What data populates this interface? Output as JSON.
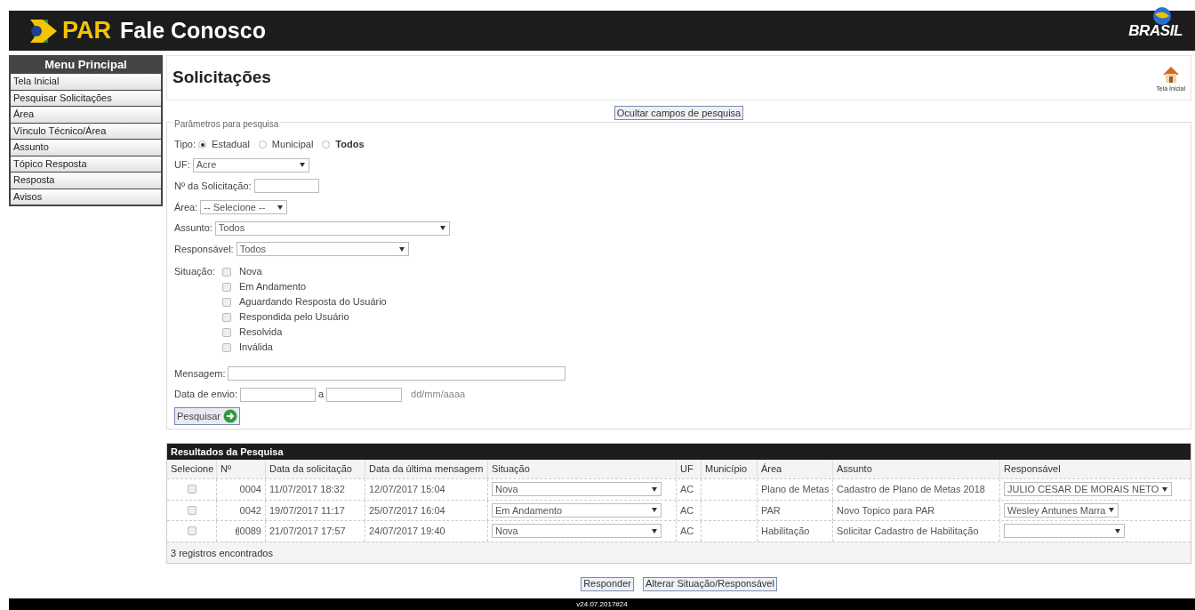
{
  "header": {
    "logo_short": "PAR",
    "title": "Fale Conosco",
    "brand": "BRASIL"
  },
  "sidebar": {
    "title": "Menu Principal",
    "items": [
      {
        "label": "Tela Inicial",
        "selected": false
      },
      {
        "label": "Pesquisar Solicitações",
        "selected": false
      },
      {
        "label": "Área",
        "selected": false
      },
      {
        "label": "Vínculo Técnico/Área",
        "selected": false
      },
      {
        "label": "Assunto",
        "selected": false
      },
      {
        "label": "Tópico Resposta",
        "selected": false
      },
      {
        "label": "Resposta",
        "selected": false
      },
      {
        "label": "Avisos",
        "selected": false
      }
    ]
  },
  "page": {
    "title": "Solicitações",
    "home_link": "Tela Inicial",
    "toggle_button": "Ocultar campos de pesquisa"
  },
  "search": {
    "legend": "Parâmetros para pesquisa",
    "tipo": {
      "label": "Tipo:",
      "options": [
        {
          "label": "Estadual",
          "selected": true,
          "bold": false
        },
        {
          "label": "Municipal",
          "selected": false,
          "bold": false
        },
        {
          "label": "Todos",
          "selected": false,
          "bold": true
        }
      ]
    },
    "uf": {
      "label": "UF:",
      "value": "Acre"
    },
    "numero": {
      "label": "Nº da Solicitação:"
    },
    "area": {
      "label": "Área:",
      "value": "-- Selecione --"
    },
    "assunto": {
      "label": "Assunto:",
      "value": "Todos"
    },
    "responsavel": {
      "label": "Responsável:",
      "value": "Todos"
    },
    "situacao": {
      "label": "Situação:",
      "options": [
        {
          "label": "Nova",
          "checked": false
        },
        {
          "label": "Em Andamento",
          "checked": false
        },
        {
          "label": "Aguardando Resposta do Usuário",
          "checked": false
        },
        {
          "label": "Respondida pelo Usuário",
          "checked": false
        },
        {
          "label": "Resolvida",
          "checked": false
        },
        {
          "label": "Inválida",
          "checked": false
        }
      ]
    },
    "mensagem": {
      "label": "Mensagem:"
    },
    "data_envio": {
      "label": "Data de envio:",
      "separator": "a",
      "hint": "dd/mm/aaaa"
    },
    "submit": "Pesquisar"
  },
  "results": {
    "title": "Resultados da Pesquisa",
    "columns": [
      "Selecione",
      "Nº",
      "Data da solicitação",
      "Data da última mensagem",
      "Situação",
      "UF",
      "Município",
      "Área",
      "Assunto",
      "Responsável"
    ],
    "rows": [
      {
        "selected": false,
        "attachment": false,
        "numero": "0004",
        "data_solicitacao": "11/07/2017 18:32",
        "data_ultima": "12/07/2017 15:04",
        "situacao": "Nova",
        "uf": "AC",
        "area": "Plano de Metas",
        "assunto": "Cadastro de Plano de Metas 2018",
        "responsavel": "JULIO CESAR DE MORAIS NETO"
      },
      {
        "selected": false,
        "attachment": false,
        "numero": "0042",
        "data_solicitacao": "19/07/2017 11:17",
        "data_ultima": "25/07/2017 16:04",
        "situacao": "Em Andamento",
        "uf": "AC",
        "area": "PAR",
        "assunto": "Novo Topico para PAR",
        "responsavel": "Wesley Antunes Marra"
      },
      {
        "selected": false,
        "attachment": true,
        "numero": "0089",
        "data_solicitacao": "21/07/2017 17:57",
        "data_ultima": "24/07/2017 19:40",
        "situacao": "Nova",
        "uf": "AC",
        "area": "Habilitação",
        "assunto": "Solicitar Cadastro de Habilitação"
      }
    ],
    "count": "3 registros encontrados"
  },
  "actions": [
    "Responder",
    "Alterar Situação/Responsável"
  ],
  "footer": {
    "version": "v24.07.2017#24"
  }
}
